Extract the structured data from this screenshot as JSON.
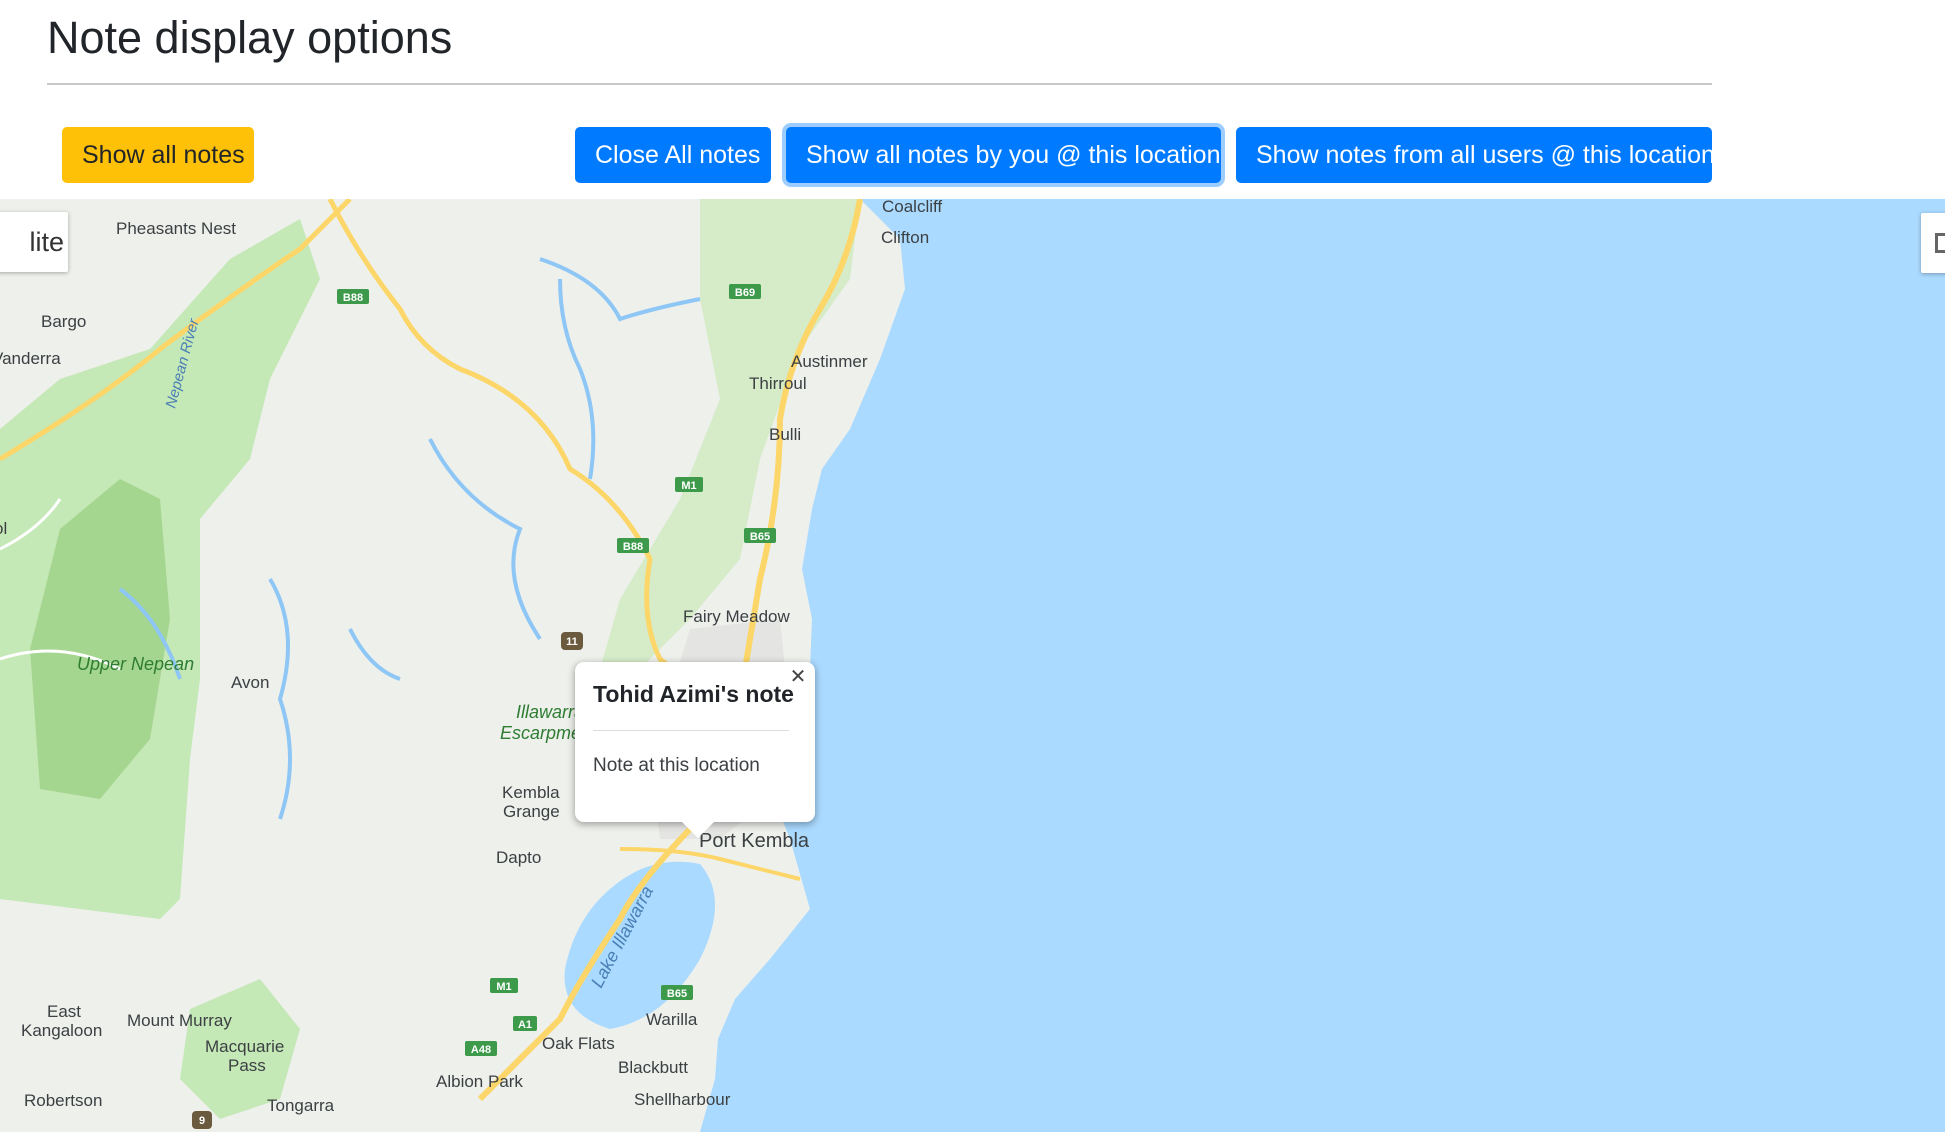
{
  "page": {
    "title": "Note display options"
  },
  "toolbar": {
    "show_all_label": "Show all notes",
    "close_all_label": "Close All notes",
    "show_mine_label": "Show all notes by you @ this location",
    "show_all_users_label": "Show notes from all users @ this location"
  },
  "map": {
    "map_type_label": "lite",
    "places": [
      "Pheasants Nest",
      "Bargo",
      "Vanderra",
      "Upper Nepean",
      "Avon",
      "Coalcliff",
      "Clifton",
      "Austinmer",
      "Thirroul",
      "Bulli",
      "Fairy Meadow",
      "Illawarra",
      "Escarpment",
      "Kembla",
      "Grange",
      "Dapto",
      "Port Kembla",
      "Warilla",
      "Oak Flats",
      "Blackbutt",
      "Albion Park",
      "Shellharbour",
      "Tongarra",
      "Robertson",
      "East",
      "Kangaloon",
      "Mount Murray",
      "Macquarie",
      "Pass",
      "ol"
    ],
    "water_labels": [
      "Nepean River",
      "Lake Illawarra"
    ],
    "road_shields": [
      "B88",
      "B69",
      "M1",
      "B88",
      "B65",
      "11",
      "M1",
      "B65",
      "A1",
      "A48",
      "9"
    ],
    "colors": {
      "land": "#eef0ec",
      "park": "#c5e8b7",
      "park_dark": "#a5d68f",
      "water": "#aadaff",
      "road": "#fcd668",
      "shield": "#3d9a4a"
    }
  },
  "info_window": {
    "title": "Tohid Azimi's note",
    "body": "Note at this location",
    "close_symbol": "✕"
  }
}
